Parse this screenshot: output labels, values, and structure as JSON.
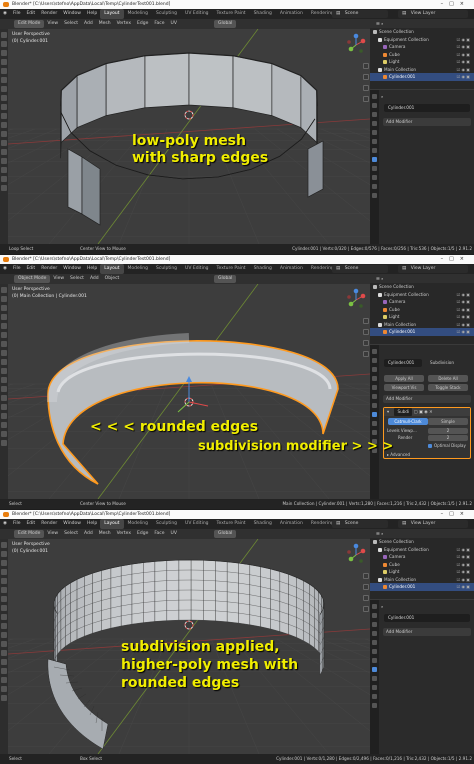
{
  "accent": {
    "yellow": "#f1ee00",
    "selection_orange": "#ff9a1f",
    "blender_orange": "#e87d0d",
    "active_blue": "#334d80"
  },
  "titlebar_text": "Blender* [C:\\Users\\stefno\\AppData\\Local\\Temp\\CylinderTest001.blend]",
  "menus": [
    "File",
    "Edit",
    "Render",
    "Window",
    "Help"
  ],
  "workspaces": [
    "Layout",
    "Modeling",
    "Sculpting",
    "UV Editing",
    "Texture Paint",
    "Shading",
    "Animation",
    "Rendering",
    "Compos"
  ],
  "scene_label": "Scene",
  "view_layer_label": "View Layer",
  "panels": [
    {
      "mode": "Edit Mode",
      "header_menus": [
        "View",
        "Select",
        "Add",
        "Mesh",
        "Vertex",
        "Edge",
        "Face",
        "UV"
      ],
      "transform": "Global",
      "view_label": "User Perspective",
      "object_label": "(0) Cylinder.001",
      "outliner": {
        "title": "Scene Collection",
        "rows": [
          "Scene Collection",
          "Equipment Collection",
          "Camera",
          "Cube",
          "Light",
          "Main Collection",
          "Cylinder.001"
        ]
      },
      "props_object": "Cylinder.001",
      "add_modifier": "Add Modifier",
      "annotation": [
        "low-poly mesh",
        "with sharp edges"
      ],
      "status": {
        "left": "Loop Select",
        "mid": "Center View to Mouse",
        "right": "Cylinder.001 | Verts:0/320 | Edges:0/576 | Faces:0/256 | Tris:536 | Objects:1/5 | 2.91.2"
      }
    },
    {
      "mode": "Object Mode",
      "header_menus": [
        "View",
        "Select",
        "Add",
        "Object"
      ],
      "transform": "Global",
      "view_label": "User Perspective",
      "object_label": "(0) Main Collection | Cylinder.001",
      "outliner": {
        "title": "Scene Collection",
        "rows": [
          "Scene Collection",
          "Equipment Collection",
          "Camera",
          "Cube",
          "Light",
          "Main Collection",
          "Cylinder.001"
        ]
      },
      "props_object": "Cylinder.001",
      "modifier_stack": "Subdivision",
      "modifier": {
        "name": "Subdi",
        "apply_all": "Apply All",
        "delete_all": "Delete All",
        "viewport_vis": "Viewport Vis",
        "toggle_stack": "Toggle Stack",
        "add_modifier": "Add Modifier",
        "mode_a": "Catmull-Clark",
        "mode_b": "Simple",
        "levels_label": "Levels Viewp...",
        "levels_value": "2",
        "render_label": "Render",
        "render_value": "2",
        "optimal_display": "Optimal Display",
        "advanced": "Advanced"
      },
      "annotation_a": "< < < rounded edges",
      "annotation_b": "subdivision modifier > > >",
      "status": {
        "left": "Select",
        "mid": "Center View to Mouse",
        "right": "Main Collection | Cylinder.001 | Verts:1,280 | Faces:1,216 | Tris:2,432 | Objects:1/5 | 2.91.2"
      }
    },
    {
      "mode": "Edit Mode",
      "header_menus": [
        "View",
        "Select",
        "Add",
        "Mesh",
        "Vertex",
        "Edge",
        "Face",
        "UV"
      ],
      "transform": "Global",
      "view_label": "User Perspective",
      "object_label": "(0) Cylinder.001",
      "outliner": {
        "title": "Scene Collection",
        "rows": [
          "Scene Collection",
          "Equipment Collection",
          "Camera",
          "Cube",
          "Light",
          "Main Collection",
          "Cylinder.001"
        ]
      },
      "props_object": "Cylinder.001",
      "add_modifier": "Add Modifier",
      "annotation": [
        "subdivision applied,",
        "higher-poly mesh with",
        "rounded edges"
      ],
      "status": {
        "left": "Select",
        "mid": "Box Select",
        "right": "Cylinder.001 | Verts:0/1,280 | Edges:0/2,496 | Faces:0/1,216 | Tris:2,432 | Objects:1/5 | 2.91.2"
      }
    }
  ]
}
